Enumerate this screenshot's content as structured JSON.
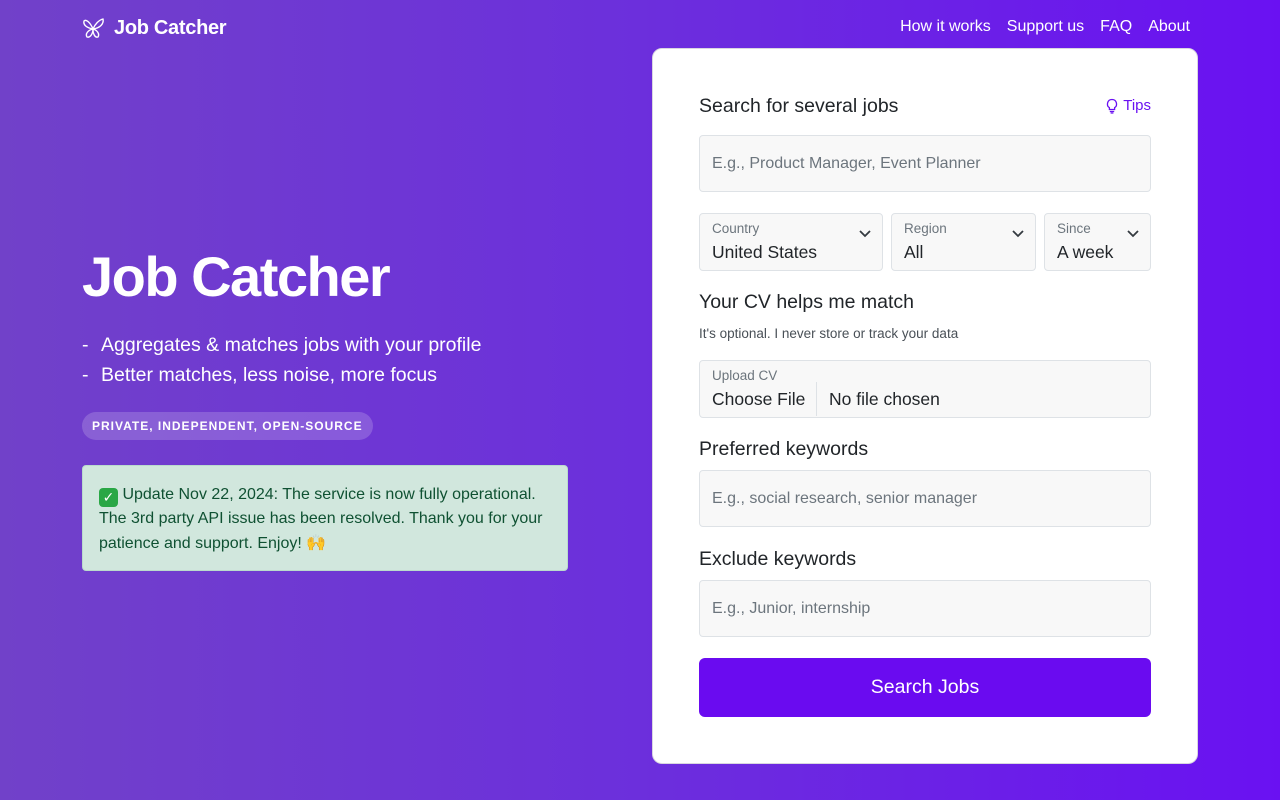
{
  "brand": {
    "name": "Job Catcher",
    "icon": "butterfly-icon"
  },
  "nav": [
    {
      "label": "How it works"
    },
    {
      "label": "Support us"
    },
    {
      "label": "FAQ"
    },
    {
      "label": "About"
    }
  ],
  "hero": {
    "title": "Job Catcher",
    "bullets": [
      "Aggregates & matches jobs with your profile",
      "Better matches, less noise, more focus"
    ],
    "badge": "PRIVATE, INDEPENDENT, OPEN-SOURCE"
  },
  "notice": {
    "text": "Update Nov 22, 2024: The service is now fully operational. The 3rd party API issue has been resolved. Thank you for your patience and support. Enjoy!",
    "emoji_end": "🙌",
    "icon": "check-mark-icon"
  },
  "form": {
    "search_label": "Search for several jobs",
    "tips_label": "Tips",
    "search_placeholder": "E.g., Product Manager, Event Planner",
    "search_value": "",
    "country": {
      "label": "Country",
      "value": "United States"
    },
    "region": {
      "label": "Region",
      "value": "All"
    },
    "since": {
      "label": "Since",
      "value": "A week"
    },
    "cv_heading": "Your CV helps me match",
    "cv_sub": "It's optional. I never store or track your data",
    "upload": {
      "label": "Upload CV",
      "button": "Choose File",
      "status": "No file chosen"
    },
    "preferred_label": "Preferred keywords",
    "preferred_placeholder": "E.g., social research, senior manager",
    "exclude_label": "Exclude keywords",
    "exclude_placeholder": "E.g., Junior, internship",
    "submit_label": "Search Jobs"
  },
  "colors": {
    "accent": "#6a0bf0",
    "notice_bg": "#d1e7dd",
    "notice_text": "#0f5132"
  }
}
